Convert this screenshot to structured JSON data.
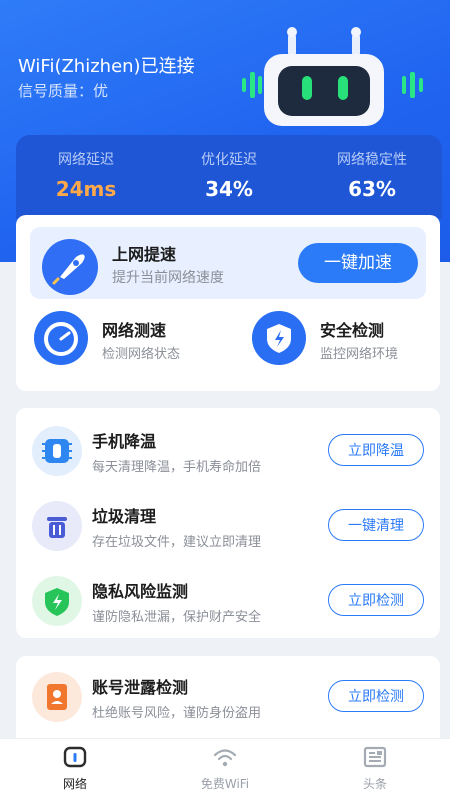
{
  "header": {
    "wifi_status": "WiFi(Zhizhen)已连接",
    "signal_quality": "信号质量：优"
  },
  "stats": [
    {
      "label": "网络延迟",
      "value": "24ms"
    },
    {
      "label": "优化延迟",
      "value": "34%"
    },
    {
      "label": "网络稳定性",
      "value": "63%"
    }
  ],
  "boost": {
    "title": "上网提速",
    "subtitle": "提升当前网络速度",
    "button": "一键加速"
  },
  "tools": [
    {
      "title": "网络测速",
      "subtitle": "检测网络状态"
    },
    {
      "title": "安全检测",
      "subtitle": "监控网络环境"
    }
  ],
  "list": [
    {
      "title": "手机降温",
      "subtitle": "每天清理降温，手机寿命加倍",
      "button": "立即降温"
    },
    {
      "title": "垃圾清理",
      "subtitle": "存在垃圾文件，建议立即清理",
      "button": "一键清理"
    },
    {
      "title": "隐私风险监测",
      "subtitle": "谨防隐私泄漏，保护财产安全",
      "button": "立即检测"
    }
  ],
  "list2": [
    {
      "title": "账号泄露检测",
      "subtitle": "杜绝账号风险，谨防身份盗用",
      "button": "立即检测"
    }
  ],
  "tabs": [
    {
      "label": "网络"
    },
    {
      "label": "免费WiFi"
    },
    {
      "label": "头条"
    }
  ],
  "colors": {
    "primary": "#2b7af7",
    "header_bg": "#1f63ef",
    "stat_highlight": "#ffa94a"
  }
}
